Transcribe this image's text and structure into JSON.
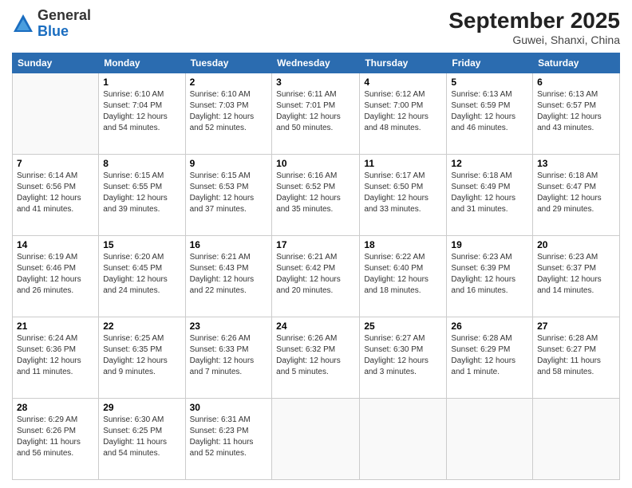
{
  "logo": {
    "general": "General",
    "blue": "Blue"
  },
  "header": {
    "month": "September 2025",
    "location": "Guwei, Shanxi, China"
  },
  "days_of_week": [
    "Sunday",
    "Monday",
    "Tuesday",
    "Wednesday",
    "Thursday",
    "Friday",
    "Saturday"
  ],
  "weeks": [
    [
      {
        "day": "",
        "sunrise": "",
        "sunset": "",
        "daylight": ""
      },
      {
        "day": "1",
        "sunrise": "6:10 AM",
        "sunset": "7:04 PM",
        "daylight": "12 hours and 54 minutes."
      },
      {
        "day": "2",
        "sunrise": "6:10 AM",
        "sunset": "7:03 PM",
        "daylight": "12 hours and 52 minutes."
      },
      {
        "day": "3",
        "sunrise": "6:11 AM",
        "sunset": "7:01 PM",
        "daylight": "12 hours and 50 minutes."
      },
      {
        "day": "4",
        "sunrise": "6:12 AM",
        "sunset": "7:00 PM",
        "daylight": "12 hours and 48 minutes."
      },
      {
        "day": "5",
        "sunrise": "6:13 AM",
        "sunset": "6:59 PM",
        "daylight": "12 hours and 46 minutes."
      },
      {
        "day": "6",
        "sunrise": "6:13 AM",
        "sunset": "6:57 PM",
        "daylight": "12 hours and 43 minutes."
      }
    ],
    [
      {
        "day": "7",
        "sunrise": "6:14 AM",
        "sunset": "6:56 PM",
        "daylight": "12 hours and 41 minutes."
      },
      {
        "day": "8",
        "sunrise": "6:15 AM",
        "sunset": "6:55 PM",
        "daylight": "12 hours and 39 minutes."
      },
      {
        "day": "9",
        "sunrise": "6:15 AM",
        "sunset": "6:53 PM",
        "daylight": "12 hours and 37 minutes."
      },
      {
        "day": "10",
        "sunrise": "6:16 AM",
        "sunset": "6:52 PM",
        "daylight": "12 hours and 35 minutes."
      },
      {
        "day": "11",
        "sunrise": "6:17 AM",
        "sunset": "6:50 PM",
        "daylight": "12 hours and 33 minutes."
      },
      {
        "day": "12",
        "sunrise": "6:18 AM",
        "sunset": "6:49 PM",
        "daylight": "12 hours and 31 minutes."
      },
      {
        "day": "13",
        "sunrise": "6:18 AM",
        "sunset": "6:47 PM",
        "daylight": "12 hours and 29 minutes."
      }
    ],
    [
      {
        "day": "14",
        "sunrise": "6:19 AM",
        "sunset": "6:46 PM",
        "daylight": "12 hours and 26 minutes."
      },
      {
        "day": "15",
        "sunrise": "6:20 AM",
        "sunset": "6:45 PM",
        "daylight": "12 hours and 24 minutes."
      },
      {
        "day": "16",
        "sunrise": "6:21 AM",
        "sunset": "6:43 PM",
        "daylight": "12 hours and 22 minutes."
      },
      {
        "day": "17",
        "sunrise": "6:21 AM",
        "sunset": "6:42 PM",
        "daylight": "12 hours and 20 minutes."
      },
      {
        "day": "18",
        "sunrise": "6:22 AM",
        "sunset": "6:40 PM",
        "daylight": "12 hours and 18 minutes."
      },
      {
        "day": "19",
        "sunrise": "6:23 AM",
        "sunset": "6:39 PM",
        "daylight": "12 hours and 16 minutes."
      },
      {
        "day": "20",
        "sunrise": "6:23 AM",
        "sunset": "6:37 PM",
        "daylight": "12 hours and 14 minutes."
      }
    ],
    [
      {
        "day": "21",
        "sunrise": "6:24 AM",
        "sunset": "6:36 PM",
        "daylight": "12 hours and 11 minutes."
      },
      {
        "day": "22",
        "sunrise": "6:25 AM",
        "sunset": "6:35 PM",
        "daylight": "12 hours and 9 minutes."
      },
      {
        "day": "23",
        "sunrise": "6:26 AM",
        "sunset": "6:33 PM",
        "daylight": "12 hours and 7 minutes."
      },
      {
        "day": "24",
        "sunrise": "6:26 AM",
        "sunset": "6:32 PM",
        "daylight": "12 hours and 5 minutes."
      },
      {
        "day": "25",
        "sunrise": "6:27 AM",
        "sunset": "6:30 PM",
        "daylight": "12 hours and 3 minutes."
      },
      {
        "day": "26",
        "sunrise": "6:28 AM",
        "sunset": "6:29 PM",
        "daylight": "12 hours and 1 minute."
      },
      {
        "day": "27",
        "sunrise": "6:28 AM",
        "sunset": "6:27 PM",
        "daylight": "11 hours and 58 minutes."
      }
    ],
    [
      {
        "day": "28",
        "sunrise": "6:29 AM",
        "sunset": "6:26 PM",
        "daylight": "11 hours and 56 minutes."
      },
      {
        "day": "29",
        "sunrise": "6:30 AM",
        "sunset": "6:25 PM",
        "daylight": "11 hours and 54 minutes."
      },
      {
        "day": "30",
        "sunrise": "6:31 AM",
        "sunset": "6:23 PM",
        "daylight": "11 hours and 52 minutes."
      },
      {
        "day": "",
        "sunrise": "",
        "sunset": "",
        "daylight": ""
      },
      {
        "day": "",
        "sunrise": "",
        "sunset": "",
        "daylight": ""
      },
      {
        "day": "",
        "sunrise": "",
        "sunset": "",
        "daylight": ""
      },
      {
        "day": "",
        "sunrise": "",
        "sunset": "",
        "daylight": ""
      }
    ]
  ],
  "labels": {
    "sunrise_prefix": "Sunrise: ",
    "sunset_prefix": "Sunset: ",
    "daylight_prefix": "Daylight: "
  }
}
